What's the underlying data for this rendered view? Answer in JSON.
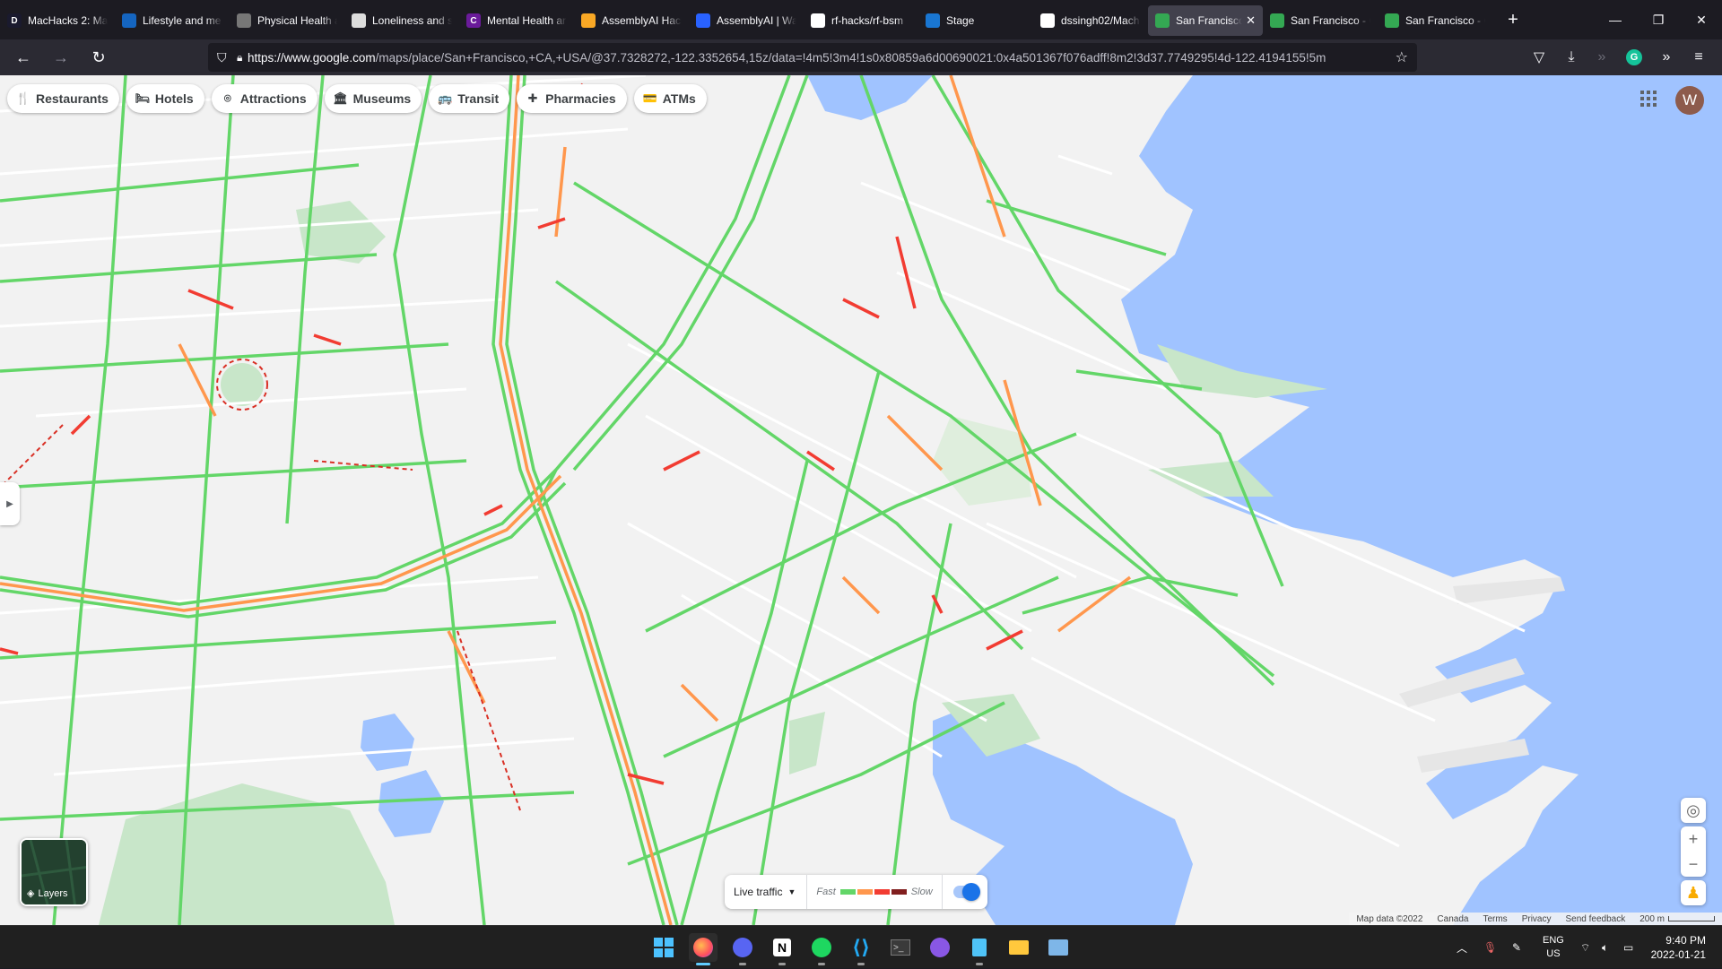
{
  "browser": {
    "tabs": [
      {
        "title": "MacHacks 2: Ma",
        "icon": "letter-d-icon",
        "icon_text": "D",
        "color": "#1a1a2e"
      },
      {
        "title": "Lifestyle and me",
        "icon": "article-icon",
        "icon_text": "",
        "color": "#1565c0"
      },
      {
        "title": "Physical Health a",
        "icon": "run-icon",
        "icon_text": "",
        "color": "#777777"
      },
      {
        "title": "Loneliness and s",
        "icon": "page-icon",
        "icon_text": "",
        "color": "#dddddd"
      },
      {
        "title": "Mental Health ar",
        "icon": "letter-c-icon",
        "icon_text": "C",
        "color": "#6a1b9a"
      },
      {
        "title": "AssemblyAI Hack",
        "icon": "person-icon",
        "icon_text": "",
        "color": "#f9a825"
      },
      {
        "title": "AssemblyAI | Wa",
        "icon": "assembly-icon",
        "icon_text": "",
        "color": "#2962ff"
      },
      {
        "title": "rf-hacks/rf-bsm",
        "icon": "github-icon",
        "icon_text": "",
        "color": "#ffffff"
      },
      {
        "title": "Stage",
        "icon": "gear-icon",
        "icon_text": "",
        "color": "#1976d2"
      },
      {
        "title": "dssingh02/Mach",
        "icon": "github-icon",
        "icon_text": "",
        "color": "#ffffff"
      },
      {
        "title": "San Francisco",
        "icon": "maps-pin-icon",
        "icon_text": "",
        "color": "#34a853",
        "active": true
      },
      {
        "title": "San Francisco - C",
        "icon": "maps-pin-icon",
        "icon_text": "",
        "color": "#34a853"
      },
      {
        "title": "San Francisco - C",
        "icon": "maps-pin-icon",
        "icon_text": "",
        "color": "#34a853"
      }
    ],
    "url_host": "https://www.google.com",
    "url_rest": "/maps/place/San+Francisco,+CA,+USA/@37.7328272,-122.3352654,15z/data=!4m5!3m4!1s0x80859a6d00690021:0x4a501367f076adff!8m2!3d37.7749295!4d-122.4194155!5m"
  },
  "maps": {
    "chips": [
      {
        "label": "Restaurants",
        "icon": "fork-knife-icon",
        "glyph": "🍴"
      },
      {
        "label": "Hotels",
        "icon": "bed-icon",
        "glyph": "🛏"
      },
      {
        "label": "Attractions",
        "icon": "camera-icon",
        "glyph": "⌾"
      },
      {
        "label": "Museums",
        "icon": "museum-icon",
        "glyph": "🏛"
      },
      {
        "label": "Transit",
        "icon": "bus-icon",
        "glyph": "🚌"
      },
      {
        "label": "Pharmacies",
        "icon": "pharmacy-icon",
        "glyph": "✚"
      },
      {
        "label": "ATMs",
        "icon": "atm-icon",
        "glyph": "💳"
      }
    ],
    "avatar_letter": "W",
    "layers_label": "Layers",
    "traffic": {
      "mode": "Live traffic",
      "fast_label": "Fast",
      "slow_label": "Slow",
      "colors": [
        "#63d668",
        "#ff974d",
        "#f23c32",
        "#811f1f"
      ]
    },
    "attribution": {
      "map_data": "Map data ©2022",
      "country": "Canada",
      "terms": "Terms",
      "privacy": "Privacy",
      "feedback": "Send feedback",
      "scale": "200 m"
    },
    "colors": {
      "water": "#a0c3ff",
      "land": "#f2f2f2",
      "park": "#c8e6c9",
      "road_fast": "#63d668",
      "road_slow": "#ff974d"
    }
  },
  "taskbar": {
    "lang_top": "ENG",
    "lang_bottom": "US",
    "time": "9:40 PM",
    "date": "2022-01-21",
    "apps": [
      "windows-start-icon",
      "firefox-icon",
      "discord-icon",
      "notion-icon",
      "spotify-icon",
      "vscode-icon",
      "terminal-icon",
      "github-desktop-icon",
      "notepad-icon",
      "file-explorer-icon",
      "photos-icon"
    ]
  }
}
